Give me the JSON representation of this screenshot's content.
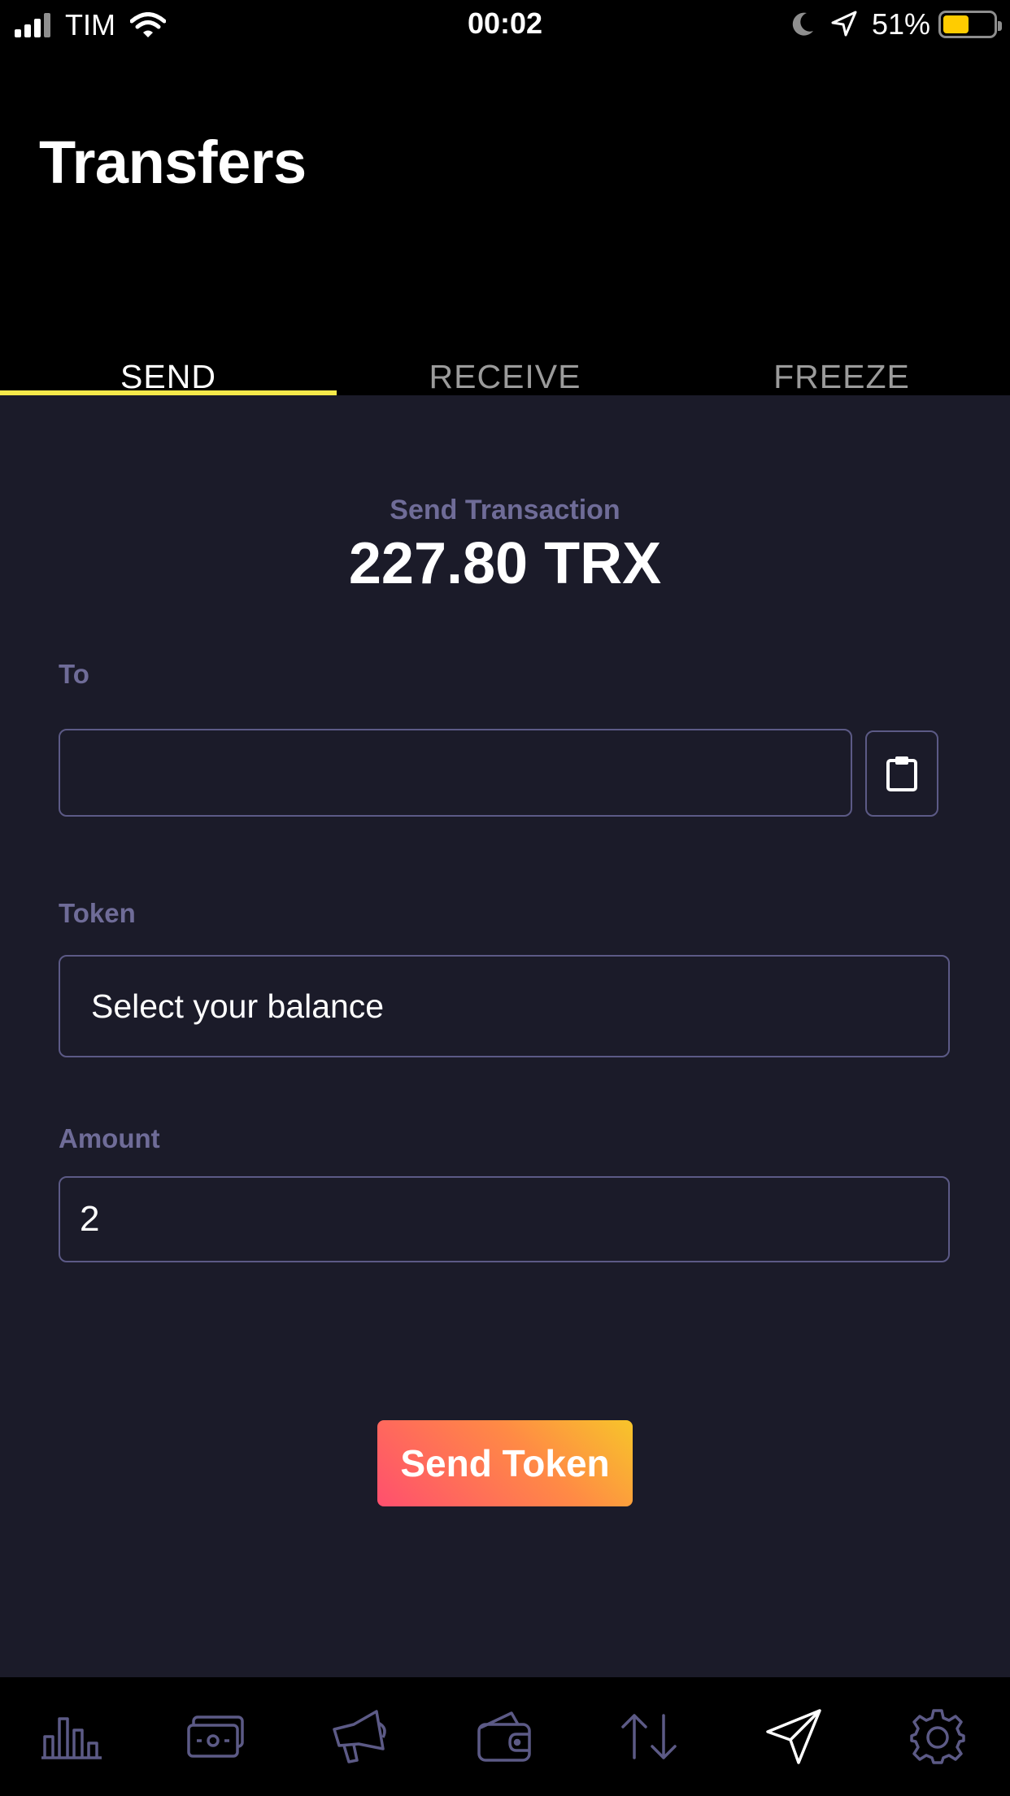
{
  "status_bar": {
    "carrier": "TIM",
    "time": "00:02",
    "battery": "51%",
    "battery_level": 0.51
  },
  "header": {
    "title": "Transfers"
  },
  "tabs": [
    {
      "label": "SEND",
      "active": true
    },
    {
      "label": "RECEIVE",
      "active": false
    },
    {
      "label": "FREEZE",
      "active": false
    }
  ],
  "send": {
    "section_label": "Send Transaction",
    "balance": "227.80 TRX",
    "to_label": "To",
    "to_value": "",
    "token_label": "Token",
    "token_value": "Select your balance",
    "amount_label": "Amount",
    "amount_value": "2",
    "submit_label": "Send Token"
  },
  "bottom_nav": [
    {
      "icon": "bar-chart-icon"
    },
    {
      "icon": "money-icon"
    },
    {
      "icon": "megaphone-icon"
    },
    {
      "icon": "wallet-icon"
    },
    {
      "icon": "transfer-arrows-icon",
      "active": true
    },
    {
      "icon": "send-icon"
    },
    {
      "icon": "settings-icon"
    }
  ],
  "colors": {
    "accent": "#f5e94a",
    "muted_label": "#6f6c98",
    "background": "#1b1b29",
    "button_gradient_start": "#ff4f6e",
    "button_gradient_end": "#f7c52a"
  }
}
